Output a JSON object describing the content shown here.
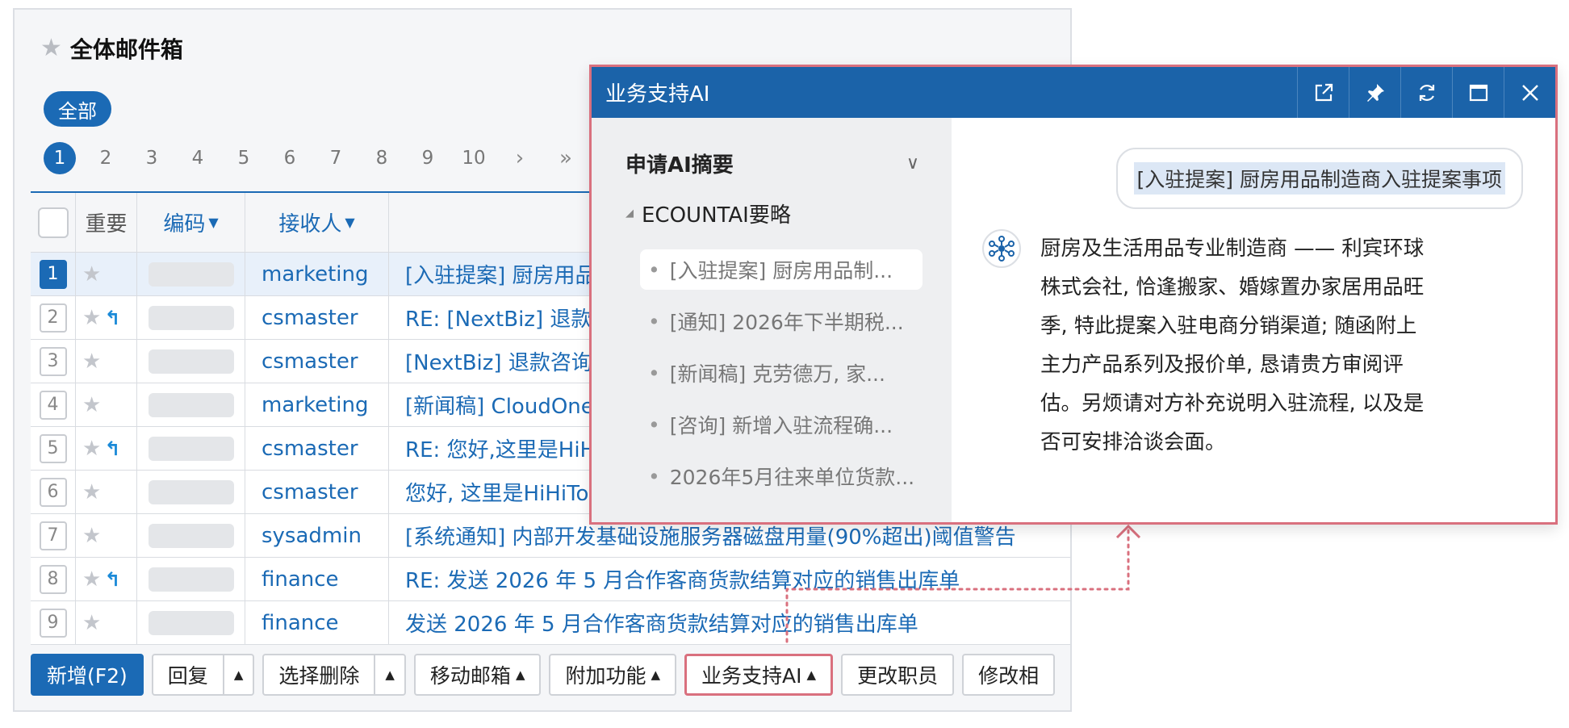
{
  "mailbox": {
    "title": "全体邮件箱",
    "filter_label": "全部",
    "pager": [
      "1",
      "2",
      "3",
      "4",
      "5",
      "6",
      "7",
      "8",
      "9",
      "10"
    ],
    "pager_next": "›",
    "pager_last": "»",
    "headers": {
      "important": "重要",
      "code": "编码",
      "recipient": "接收人"
    },
    "rows": [
      {
        "num": "1",
        "reply": false,
        "recipient": "marketing",
        "subject": "[入驻提案] 厨房用品",
        "selected": true
      },
      {
        "num": "2",
        "reply": true,
        "recipient": "csmaster",
        "subject": "RE: [NextBiz] 退款咨",
        "selected": false
      },
      {
        "num": "3",
        "reply": false,
        "recipient": "csmaster",
        "subject": "[NextBiz] 退款咨询",
        "selected": false
      },
      {
        "num": "4",
        "reply": false,
        "recipient": "marketing",
        "subject": "[新闻稿] CloudOne,",
        "selected": false
      },
      {
        "num": "5",
        "reply": true,
        "recipient": "csmaster",
        "subject": "RE: 您好,这里是HiH",
        "selected": false
      },
      {
        "num": "6",
        "reply": false,
        "recipient": "csmaster",
        "subject": "您好, 这里是HiHiTo",
        "selected": false
      },
      {
        "num": "7",
        "reply": false,
        "recipient": "sysadmin",
        "subject": "[系统通知] 内部开发基础设施服务器磁盘用量(90%超出)阈值警告",
        "selected": false
      },
      {
        "num": "8",
        "reply": true,
        "recipient": "finance",
        "subject": "RE: 发送 2026 年 5 月合作客商货款结算对应的销售出库单",
        "selected": false
      },
      {
        "num": "9",
        "reply": false,
        "recipient": "finance",
        "subject": "发送 2026 年 5 月合作客商货款结算对应的销售出库单",
        "selected": false
      }
    ]
  },
  "toolbar": {
    "new": "新增(F2)",
    "reply": "回复",
    "select_delete": "选择删除",
    "move": "移动邮箱",
    "addon": "附加功能",
    "ai": "业务支持AI",
    "change_staff": "更改职员",
    "modify": "修改相"
  },
  "ai_popup": {
    "title": "业务支持AI",
    "sidebar_header": "申请AI摘要",
    "group": "ECOUNTAI要略",
    "items": [
      "[入驻提案] 厨房用品制...",
      "[通知] 2026年下半期税...",
      "[新闻稿] 克劳德万, 家...",
      "[咨询] 新增入驻流程确...",
      "2026年5月往来单位货款..."
    ],
    "query": "[入驻提案] 厨房用品制造商入驻提案事项",
    "answer": "厨房及生活用品专业制造商 —— 利宾环球株式会社, 恰逢搬家、婚嫁置办家居用品旺季, 特此提案入驻电商分销渠道; 随函附上主力产品系列及报价单, 恳请贵方审阅评估。另烦请对方补充说明入驻流程, 以及是否可安排洽谈会面。"
  },
  "colors": {
    "primary": "#1b6ab5",
    "highlight": "#d9707e",
    "popup_header": "#1b63a9"
  }
}
